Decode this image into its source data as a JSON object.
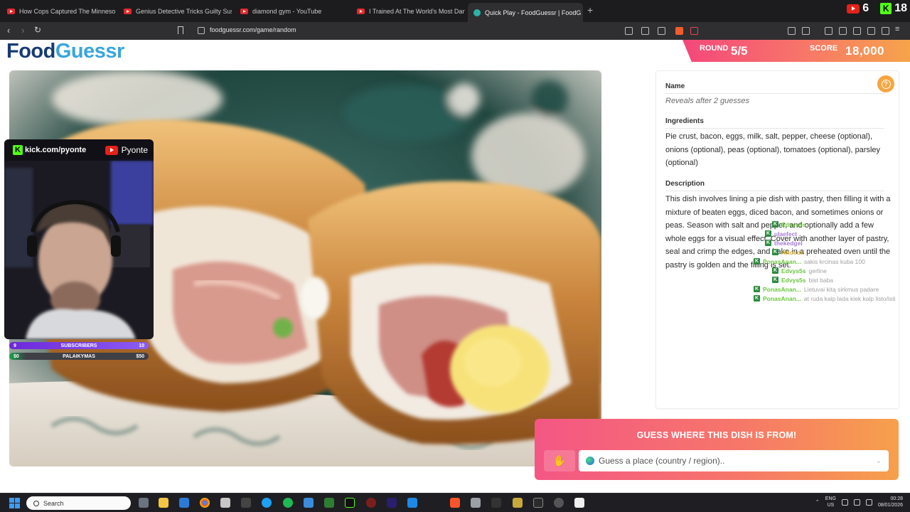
{
  "browser": {
    "tabs": [
      {
        "title": "How Cops Captured The Minnesota K",
        "active": false
      },
      {
        "title": "Genius Detective Tricks Guilty Suspec",
        "active": false
      },
      {
        "title": "diamond gym - YouTube",
        "active": false
      },
      {
        "title": "I Trained At The World's Most Dange",
        "active": false
      },
      {
        "title": "Quick Play - FoodGuessr | FoodG",
        "active": true
      }
    ],
    "new_tab": "+",
    "url": "foodguessr.com/game/random",
    "youtube_count": "6",
    "kick_count": "18"
  },
  "game": {
    "logo_food": "Food",
    "logo_guessr": "Guessr",
    "round_label": "ROUND",
    "round_value": "5/5",
    "score_label": "SCORE",
    "score_value": "18,000"
  },
  "info": {
    "name_label": "Name",
    "name_text": "Reveals after 2 guesses",
    "ingredients_label": "Ingredients",
    "ingredients_text": "Pie crust, bacon, eggs, milk, salt, pepper, cheese (optional), onions (optional), peas (optional), tomatoes (optional), parsley (optional)",
    "description_label": "Description",
    "description_text": "This dish involves lining a pie dish with pastry, then filling it with a mixture of beaten eggs, diced bacon, and sometimes onions or peas. Season with salt and pepper, and optionally add a few whole eggs for a visual effect. Cover with another layer of pastry, seal and crimp the edges, and bake in a preheated oven until the pastry is golden and the filling is set."
  },
  "guess": {
    "title": "GUESS WHERE THIS DISH IS FROM!",
    "placeholder": "Guess a place (country / region).."
  },
  "stream": {
    "kick_handle": "kick.com/pyonte",
    "yt_handle": "Pyonte",
    "subs_left": "9",
    "subs_label": "SUBSCRIBERS",
    "subs_right": "10",
    "donation_left": "$0",
    "donation_label": "PALAIKYMAS",
    "donation_right": "$50"
  },
  "chat": [
    {
      "user": "Edvys5s",
      "msg": ""
    },
    {
      "user": "ulaefect",
      "msg": ""
    },
    {
      "user": "thekedgel",
      "msg": ""
    },
    {
      "user": "Aftoedk",
      "msg": ""
    },
    {
      "user": "PonasAnan...",
      "msg": "sakis krcinas kuba 100"
    },
    {
      "user": "Edvys5s",
      "msg": "gerline"
    },
    {
      "user": "Edvys5s",
      "msg": "bist baba"
    },
    {
      "user": "PonasAnan...",
      "msg": "Lietuvai kitą sirkmus padare"
    },
    {
      "user": "PonasAnan...",
      "msg": "at ruda kaip lada kiek kalp listo/isti"
    }
  ],
  "taskbar": {
    "search_placeholder": "Search",
    "lang_top": "ENG",
    "lang_bottom": "US",
    "time": "00:28",
    "date": "08/01/2026"
  },
  "colors": {
    "brand_dark": "#173b73",
    "brand_light": "#3aa5dd",
    "accent_pink": "#f45685",
    "accent_orange": "#f6a04c",
    "help_orange": "#f7a541"
  }
}
